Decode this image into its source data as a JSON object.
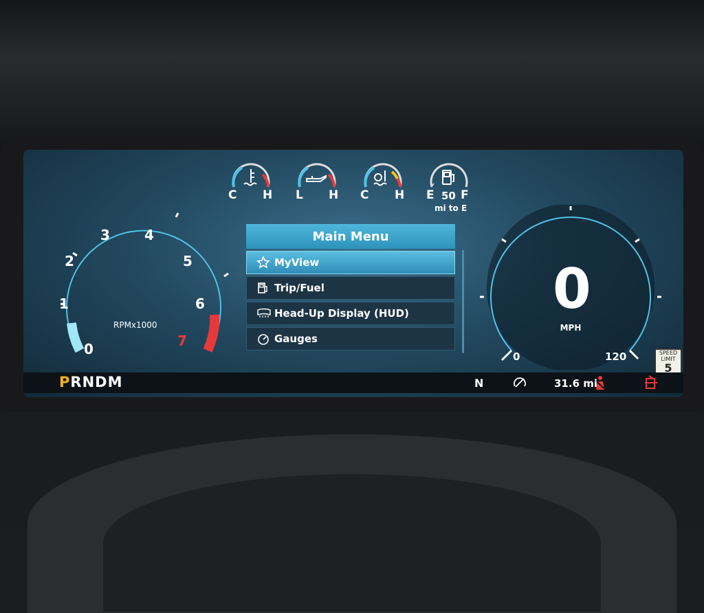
{
  "top_gauges": {
    "coolant": {
      "low": "C",
      "high": "H"
    },
    "oil": {
      "low": "L",
      "high": "H"
    },
    "trans": {
      "low": "C",
      "high": "H"
    },
    "fuel": {
      "low": "E",
      "high": "F",
      "range": "50",
      "range_unit": "mi to E"
    }
  },
  "tachometer": {
    "ticks": [
      "0",
      "1",
      "2",
      "3",
      "4",
      "5",
      "6",
      "7"
    ],
    "unit": "RPMx1000"
  },
  "menu": {
    "title": "Main Menu",
    "items": [
      {
        "label": "MyView",
        "icon": "star-icon"
      },
      {
        "label": "Trip/Fuel",
        "icon": "fuel-pump-icon"
      },
      {
        "label": "Head-Up Display (HUD)",
        "icon": "hud-icon"
      },
      {
        "label": "Gauges",
        "icon": "gauge-icon"
      }
    ]
  },
  "speedometer": {
    "speed": "0",
    "unit": "MPH",
    "min": "0",
    "max": "120"
  },
  "speed_limit": {
    "line1": "SPEED",
    "line2": "LIMIT",
    "value": "5"
  },
  "status_bar": {
    "gear_selector_active": "P",
    "gear_selector_rest": "RNDM",
    "current_gear": "N",
    "odometer": "31.6 mi"
  },
  "colors": {
    "accent": "#4fb6da",
    "warning": "#e63a3a",
    "gear_active": "#f3b21b"
  }
}
